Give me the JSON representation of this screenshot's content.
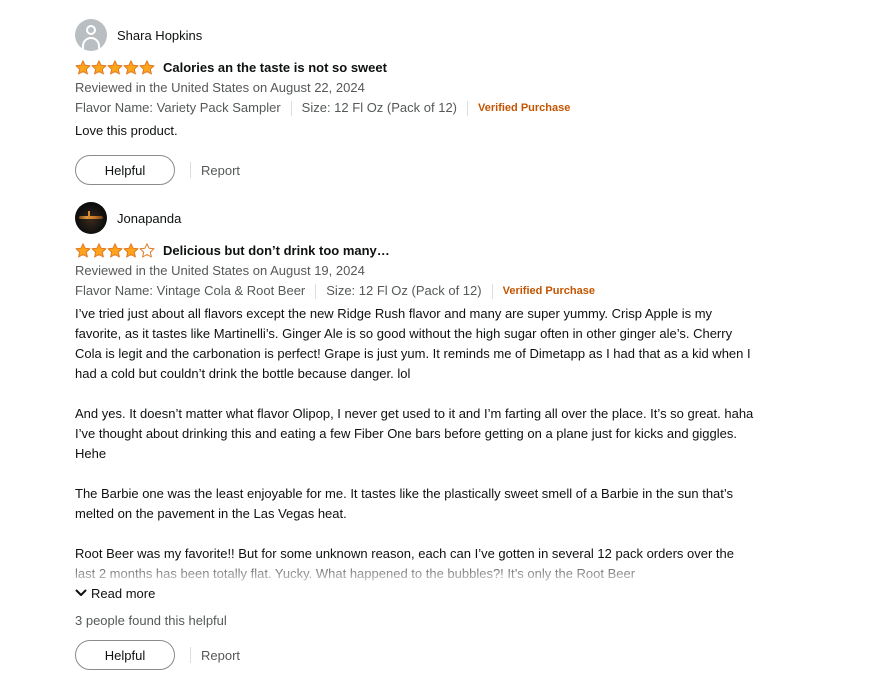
{
  "colors": {
    "star_fill": "#FFA41C",
    "star_stroke": "#DE7921",
    "verified": "#C45500",
    "text": "#0F1111",
    "muted": "#565959"
  },
  "reviews": [
    {
      "reviewer": "Shara Hopkins",
      "avatar": "default-avatar-icon",
      "rating": 5,
      "title": "Calories an the taste is not so sweet",
      "date_line": "Reviewed in the United States on August 22, 2024",
      "flavor": "Flavor Name: Variety Pack Sampler",
      "size": "Size: 12 Fl Oz (Pack of 12)",
      "verified": "Verified Purchase",
      "body": [
        "Love this product."
      ],
      "helpful_label": "Helpful",
      "report_label": "Report"
    },
    {
      "reviewer": "Jonapanda",
      "avatar": "photo-avatar",
      "rating": 4,
      "title": "Delicious but don’t drink too many…",
      "date_line": "Reviewed in the United States on August 19, 2024",
      "flavor": "Flavor Name: Vintage Cola & Root Beer",
      "size": "Size: 12 Fl Oz (Pack of 12)",
      "verified": "Verified Purchase",
      "body": [
        "I’ve tried just about all flavors except the new Ridge Rush flavor and many are super yummy. Crisp Apple is my favorite, as it tastes like Martinelli’s. Ginger Ale is so good without the high sugar often in other ginger ale’s. Cherry Cola is legit and the carbonation is perfect! Grape is just yum. It reminds me of Dimetapp as I had that as a kid when I had a cold but couldn’t drink the bottle because danger. lol",
        "And yes. It doesn’t matter what flavor Olipop, I never get used to it and I’m farting all over the place. It’s so great. haha I’ve thought about drinking this and eating a few Fiber One bars before getting on a plane just for kicks and giggles. Hehe",
        "The Barbie one was the least enjoyable for me. It tastes like the plastically sweet smell of a Barbie in the sun that’s melted on the pavement in the Las Vegas heat.",
        "Root Beer was my favorite!! But for some unknown reason, each can I’ve gotten in several 12 pack orders over the last 2 months has been totally flat. Yucky. What happened to the bubbles?! It’s only the Root Beer"
      ],
      "read_more": "Read more",
      "helpful_count": "3 people found this helpful",
      "helpful_label": "Helpful",
      "report_label": "Report"
    }
  ]
}
